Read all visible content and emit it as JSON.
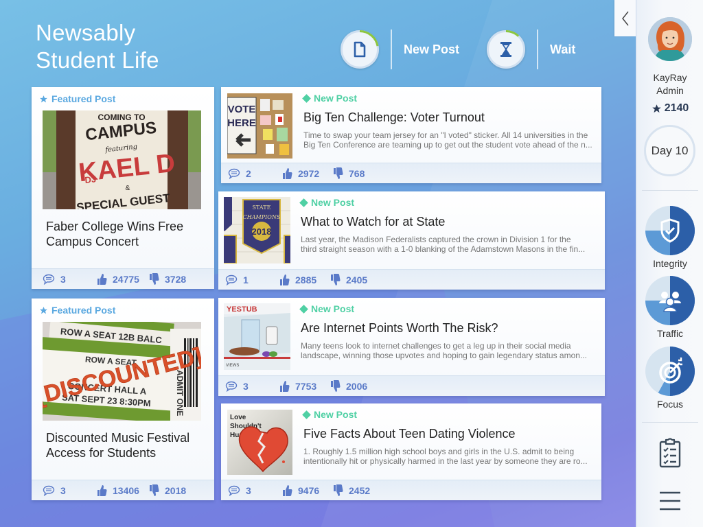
{
  "header": {
    "brand_line1": "Newsably",
    "brand_line2": "Student Life",
    "actions": [
      {
        "label": "New Post",
        "icon": "document-icon",
        "progress": 0.22
      },
      {
        "label": "Wait",
        "icon": "hourglass-icon",
        "progress": 0.12
      }
    ]
  },
  "colors": {
    "accent": "#5aa8e0",
    "new_post": "#4fd0a4",
    "stat": "#5a7ac8",
    "progress": "#8cc63f",
    "meter_dark": "#2c5fa8",
    "meter_light": "#5c9ad6"
  },
  "featured_posts": [
    {
      "tag": "Featured Post",
      "title": "Faber College Wins Free Campus Concert",
      "image_text": [
        "COMING TO",
        "CAMPUS",
        "featuring",
        "DJ",
        "KAEL D",
        "&",
        "SPECIAL GUEST"
      ],
      "comments": "3",
      "likes": "24775",
      "dislikes": "3728"
    },
    {
      "tag": "Featured Post",
      "title": "Discounted Music Festival Access for Students",
      "image_text": [
        "ROW A SEAT 12B BALC",
        "ROW A SEAT",
        "CONCERT HALL A",
        "SAT SEPT 23 8:30PM",
        "[DISCOUNTED]",
        "ADMIT ONE"
      ],
      "comments": "3",
      "likes": "13406",
      "dislikes": "2018"
    }
  ],
  "posts": [
    {
      "tag": "New Post",
      "title": "Big Ten Challenge: Voter Turnout",
      "desc_line1": "Time to swap your team jersey for an \"I voted\" sticker. All 14 universities in the",
      "desc_line2": "Big Ten Conference are teaming up to get out the student vote ahead of the n...",
      "image_text": [
        "VOTE",
        "HERE"
      ],
      "comments": "2",
      "likes": "2972",
      "dislikes": "768"
    },
    {
      "tag": "New Post",
      "title": "What to Watch for at State",
      "desc_line1": "Last year, the Madison Federalists captured the crown in Division 1 for the",
      "desc_line2": "third straight season with a 1-0 blanking of the Adamstown Masons in the fin...",
      "image_text": [
        "STATE",
        "CHAMPIONS",
        "2018"
      ],
      "comments": "1",
      "likes": "2885",
      "dislikes": "2405"
    },
    {
      "tag": "New Post",
      "title": "Are Internet Points Worth The Risk?",
      "desc_line1": "Many teens look to internet challenges to get a leg up in their social media",
      "desc_line2": "landscape, winning those upvotes and hoping to gain legendary status amon...",
      "image_text": [
        "YESTUB",
        "VIEWS"
      ],
      "comments": "3",
      "likes": "7753",
      "dislikes": "2006"
    },
    {
      "tag": "New Post",
      "title": "Five Facts About Teen Dating Violence",
      "desc_line1": "1. Roughly 1.5 million high school boys and girls in the U.S. admit to being",
      "desc_line2": "intentionally hit or physically harmed in the last year by someone they are ro...",
      "image_text": [
        "Love",
        "Shouldn't",
        "Hurt."
      ],
      "comments": "3",
      "likes": "9476",
      "dislikes": "2452"
    }
  ],
  "sidebar": {
    "user_name": "KayRay",
    "user_role": "Admin",
    "score": "2140",
    "day": "Day 10",
    "meters": [
      {
        "label": "Integrity",
        "icon": "shield-check-icon",
        "level": 0.75
      },
      {
        "label": "Traffic",
        "icon": "users-icon",
        "level": 0.75
      },
      {
        "label": "Focus",
        "icon": "target-icon",
        "level": 0.58
      }
    ]
  }
}
